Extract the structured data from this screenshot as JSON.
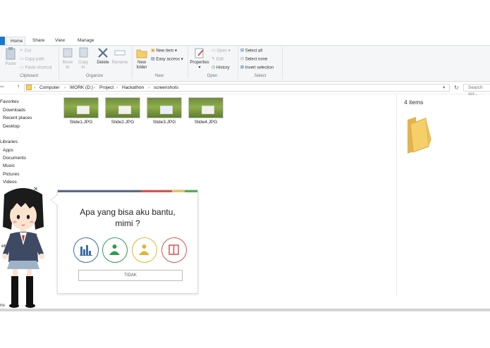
{
  "tabs": [
    "Home",
    "Share",
    "View",
    "Manage"
  ],
  "ribbon": {
    "clipboard": {
      "paste": "Paste",
      "cut": "Cut",
      "copy_path": "Copy path",
      "paste_shortcut": "Paste shortcut",
      "label": "Clipboard"
    },
    "organize": {
      "move_to": "Move to",
      "copy_to": "Copy to",
      "delete": "Delete",
      "rename": "Rename",
      "label": "Organize"
    },
    "new": {
      "new_folder": "New folder",
      "new_item": "New item",
      "easy_access": "Easy access",
      "label": "New"
    },
    "open": {
      "properties": "Properties",
      "open": "Open",
      "edit": "Edit",
      "history": "History",
      "label": "Open"
    },
    "select": {
      "select_all": "Select all",
      "select_none": "Select none",
      "invert_selection": "Invert selection",
      "label": "Select"
    }
  },
  "address": {
    "crumbs": [
      "Computer",
      "WORK (D:)",
      "Project",
      "Hackathon",
      "screenshots"
    ],
    "search_placeholder": "Search scr..."
  },
  "nav_pane": {
    "items": [
      "Favorites",
      "Downloads",
      "Recent places",
      "Desktop",
      "Libraries",
      "Apps",
      "Documents",
      "Music",
      "Pictures",
      "Videos"
    ],
    "partial": [
      "etw",
      "ns"
    ]
  },
  "files": [
    "Slide1.JPG",
    "Slide2.JPG",
    "Slide3.JPG",
    "Slide4.JPG"
  ],
  "details": {
    "count": "4 items"
  },
  "assistant": {
    "question_line1": "Apa yang bisa aku bantu,",
    "question_line2": "mimi ?",
    "cancel_label": "TIDAK",
    "close_glyph": "×",
    "options": [
      "chart-icon",
      "person-green-icon",
      "person-yellow-icon",
      "book-icon"
    ]
  },
  "colors": {
    "accent_blue": "#1979ca",
    "stripe": [
      "#5a6a88",
      "#d9534f",
      "#e8c547",
      "#4caf50"
    ],
    "option_borders": [
      "#3a6ea5",
      "#2e9d4e",
      "#e3b52c",
      "#d9534f"
    ],
    "folder": "#f4cf6a"
  }
}
